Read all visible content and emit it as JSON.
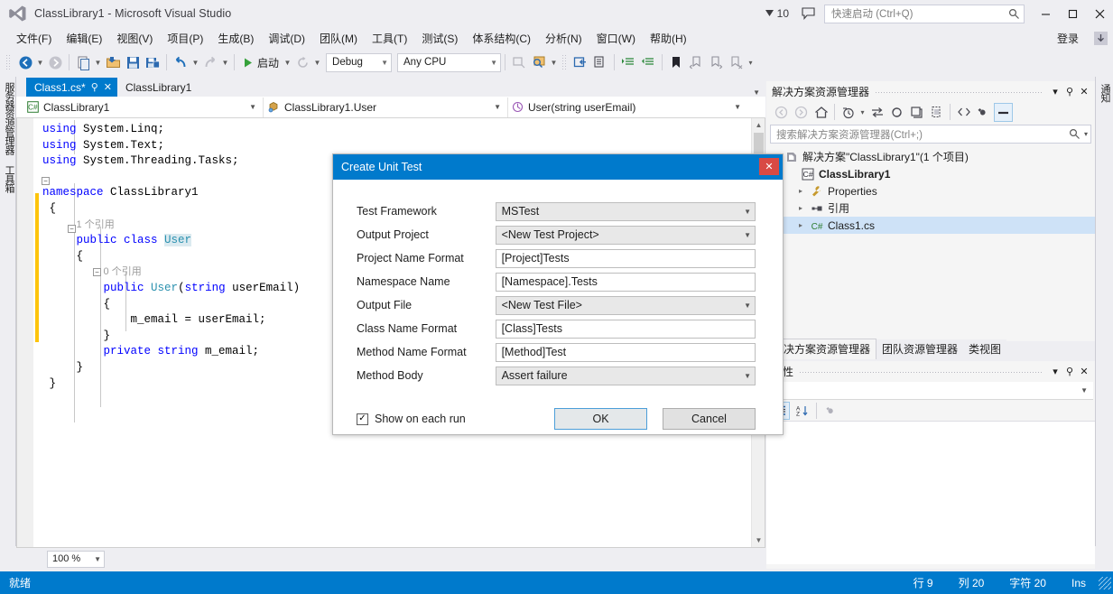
{
  "titlebar": {
    "app_title": "ClassLibrary1 - Microsoft Visual Studio",
    "warning_count": "10",
    "quick_launch_placeholder": "快速启动 (Ctrl+Q)",
    "minimize": "–",
    "maximize": "❑",
    "close": "✕"
  },
  "menubar": {
    "items": [
      {
        "label": "文件(F)"
      },
      {
        "label": "编辑(E)"
      },
      {
        "label": "视图(V)"
      },
      {
        "label": "项目(P)"
      },
      {
        "label": "生成(B)"
      },
      {
        "label": "调试(D)"
      },
      {
        "label": "团队(M)"
      },
      {
        "label": "工具(T)"
      },
      {
        "label": "测试(S)"
      },
      {
        "label": "体系结构(C)"
      },
      {
        "label": "分析(N)"
      },
      {
        "label": "窗口(W)"
      },
      {
        "label": "帮助(H)"
      }
    ],
    "signin_label": "登录"
  },
  "toolbar": {
    "run_label": "启动",
    "configuration": "Debug",
    "platform": "Any CPU"
  },
  "left_dock": {
    "tabs": [
      {
        "label": "服务器资源管理器"
      },
      {
        "label": "工具箱"
      }
    ]
  },
  "right_dock": {
    "tabs": [
      {
        "label": "通知"
      }
    ]
  },
  "editor": {
    "tabs": [
      {
        "label": "Class1.cs*",
        "active": true
      },
      {
        "label": "ClassLibrary1",
        "active": false
      }
    ],
    "nav_project": "ClassLibrary1",
    "nav_type": "ClassLibrary1.User",
    "nav_member": "User(string userEmail)",
    "zoom_level": "100 %",
    "code_lines": [
      {
        "text": "using System.Linq;"
      },
      {
        "text": "using System.Text;"
      },
      {
        "text": "using System.Threading.Tasks;"
      },
      {
        "text": ""
      },
      {
        "text": "namespace ClassLibrary1"
      },
      {
        "text": "{"
      },
      {
        "text": "    1 个引用"
      },
      {
        "text": "    public class User"
      },
      {
        "text": "    {"
      },
      {
        "text": "        0 个引用"
      },
      {
        "text": "        public User(string userEmail)"
      },
      {
        "text": "        {"
      },
      {
        "text": "            m_email = userEmail;"
      },
      {
        "text": "        }"
      },
      {
        "text": "        private string m_email;"
      },
      {
        "text": "    }"
      },
      {
        "text": "}"
      }
    ],
    "codereflens_1": "1 个引用",
    "codereflens_2": "0 个引用"
  },
  "solution_explorer": {
    "title": "解决方案资源管理器",
    "search_placeholder": "搜索解决方案资源管理器(Ctrl+;)",
    "tree": [
      {
        "label": "解决方案\"ClassLibrary1\"(1 个项目)",
        "icon": "solution-icon",
        "indent": 0,
        "bold": false,
        "twisty": "",
        "selected": false
      },
      {
        "label": "ClassLibrary1",
        "icon": "csharp-project-icon",
        "indent": 1,
        "bold": true,
        "twisty": "",
        "selected": false
      },
      {
        "label": "Properties",
        "icon": "wrench-icon",
        "indent": 2,
        "bold": false,
        "twisty": "▸",
        "selected": false
      },
      {
        "label": "引用",
        "icon": "references-icon",
        "indent": 2,
        "bold": false,
        "twisty": "▸",
        "selected": false
      },
      {
        "label": "Class1.cs",
        "icon": "csharp-file-icon",
        "indent": 2,
        "bold": false,
        "twisty": "▸",
        "selected": true
      }
    ]
  },
  "panel_tabs": [
    {
      "label": "解决方案资源管理器",
      "active": true
    },
    {
      "label": "团队资源管理器",
      "active": false
    },
    {
      "label": "类视图",
      "active": false
    }
  ],
  "properties_panel": {
    "title": "属性"
  },
  "dialog": {
    "title": "Create Unit Test",
    "close_label": "✕",
    "fields": [
      {
        "label": "Test Framework",
        "value": "MSTest",
        "type": "combo"
      },
      {
        "label": "Output Project",
        "value": "<New Test Project>",
        "type": "combo"
      },
      {
        "label": "Project Name Format",
        "value": "[Project]Tests",
        "type": "text"
      },
      {
        "label": "Namespace Name",
        "value": "[Namespace].Tests",
        "type": "text"
      },
      {
        "label": "Output File",
        "value": "<New Test File>",
        "type": "combo"
      },
      {
        "label": "Class Name Format",
        "value": "[Class]Tests",
        "type": "text"
      },
      {
        "label": "Method Name Format",
        "value": "[Method]Test",
        "type": "text"
      },
      {
        "label": "Method Body",
        "value": "Assert failure",
        "type": "combo"
      }
    ],
    "checkbox_label": "Show on each run",
    "checkbox_checked": true,
    "ok_label": "OK",
    "cancel_label": "Cancel"
  },
  "statusbar": {
    "status": "就绪",
    "line": "行 9",
    "column": "列 20",
    "character": "字符 20",
    "insert_mode": "Ins"
  },
  "colors": {
    "accent": "#007acc",
    "titlebar_bg": "#eeeef2",
    "selection": "#cee2f7",
    "change_bar": "#fdc40b"
  }
}
